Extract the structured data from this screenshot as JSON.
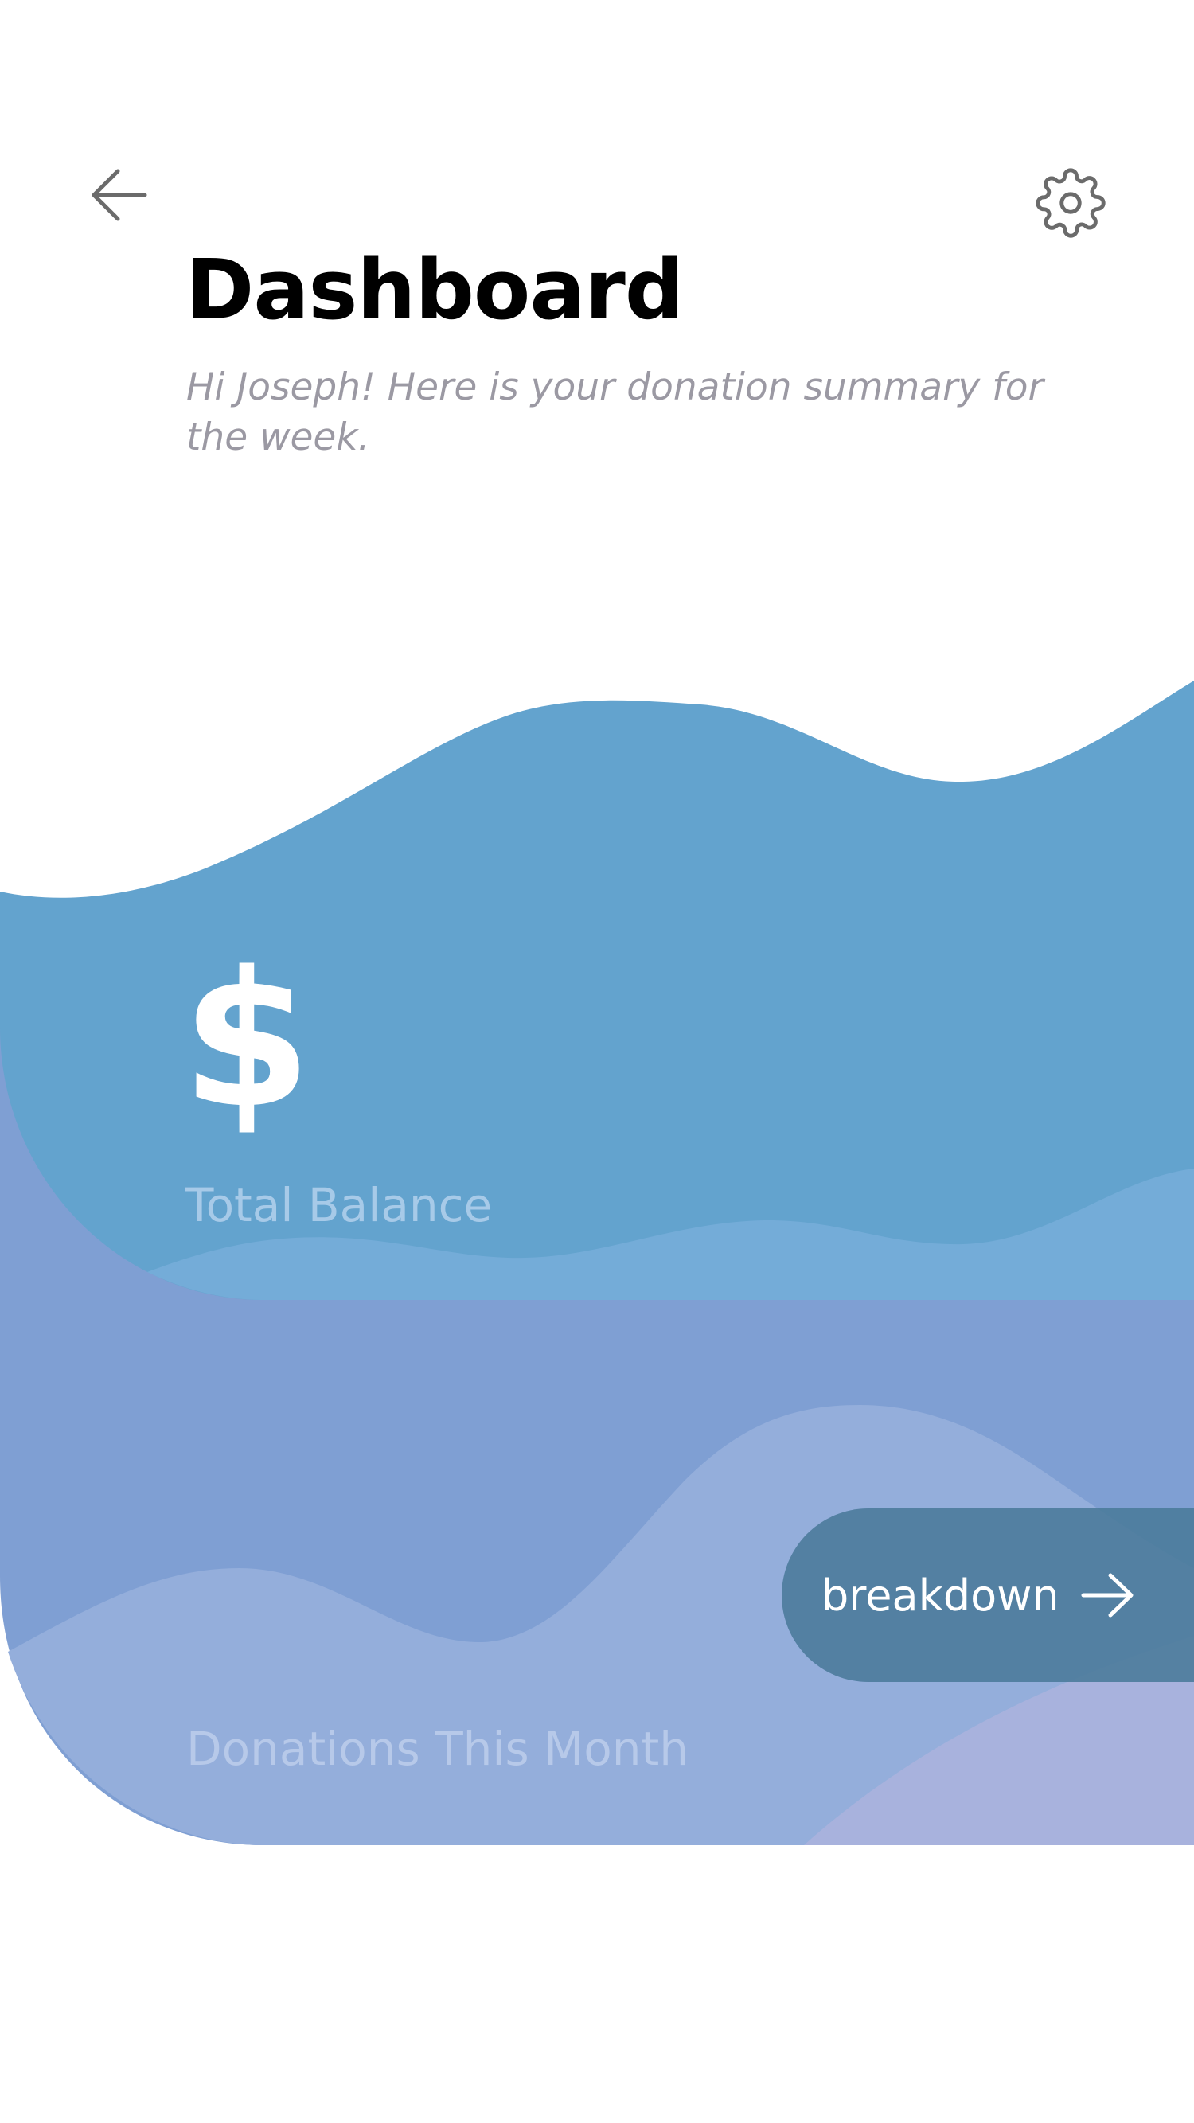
{
  "header": {
    "back_icon": "arrow-left-icon",
    "settings_icon": "gear-icon",
    "title": "Dashboard",
    "subtitle": "Hi Joseph! Here is your donation summary for the week."
  },
  "balance_card": {
    "icon": "dollar-icon",
    "currency_symbol": "$",
    "label": "Total Balance",
    "color": "#63a3ce"
  },
  "donations_card": {
    "label": "Donations This Month",
    "color": "#7f9fd3",
    "button": {
      "label": "breakdown",
      "icon": "arrow-right-icon",
      "color": "#4b7b9b"
    }
  }
}
